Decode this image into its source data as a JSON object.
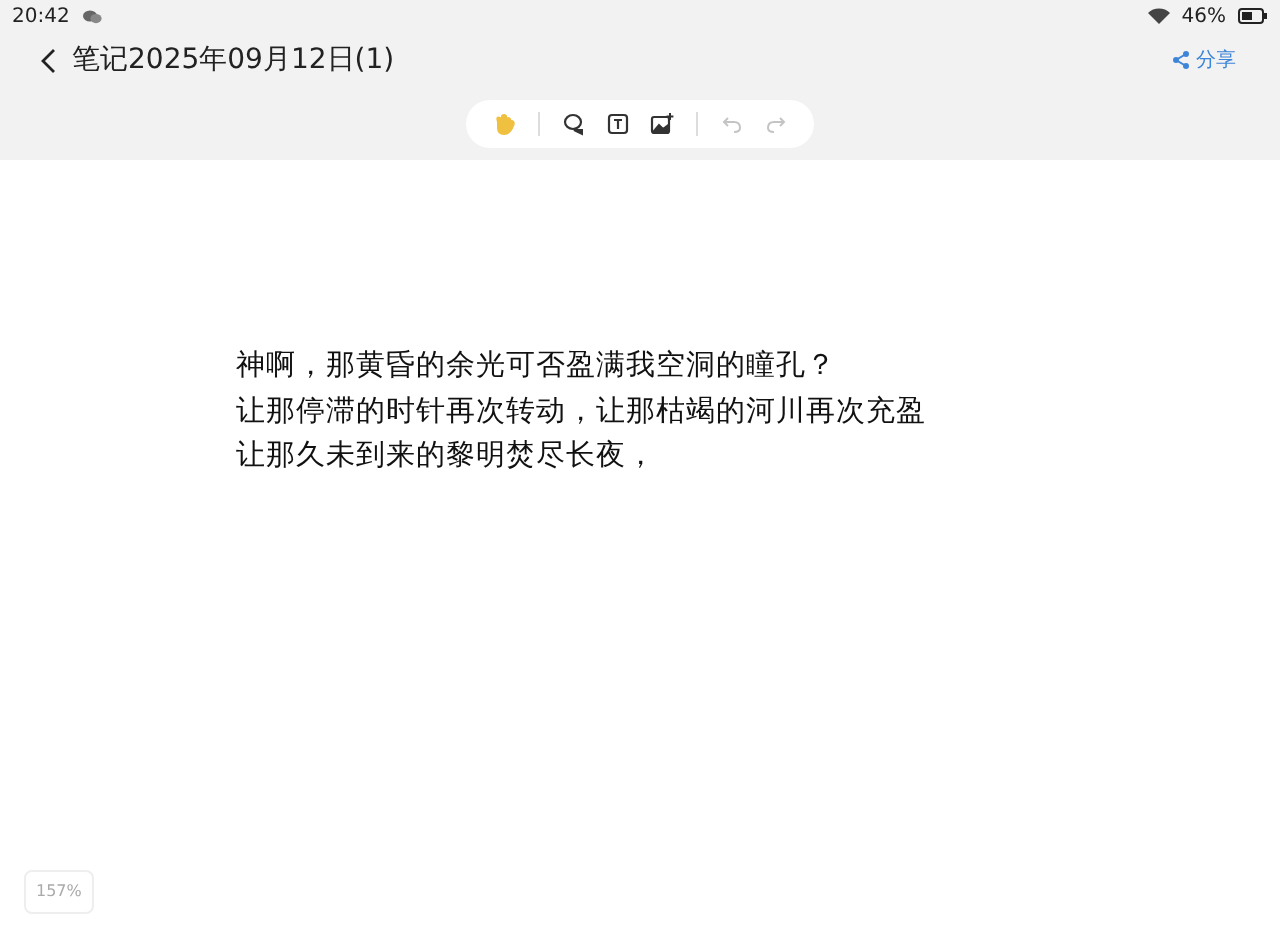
{
  "status_bar": {
    "time": "20:42",
    "battery": "46%"
  },
  "header": {
    "title": "笔记2025年09月12日(1)",
    "share": "分享"
  },
  "toolbar": {
    "tools": [
      {
        "kind": "hand",
        "selected": true,
        "disabled": false
      },
      {
        "kind": "lasso",
        "selected": false,
        "disabled": false
      },
      {
        "kind": "text",
        "selected": false,
        "disabled": false
      },
      {
        "kind": "image",
        "selected": false,
        "disabled": false
      },
      {
        "kind": "undo",
        "selected": false,
        "disabled": true
      },
      {
        "kind": "redo",
        "selected": false,
        "disabled": true
      }
    ]
  },
  "note": {
    "lines": [
      "神啊，那黄昏的余光可否盈满我空洞的瞳孔？",
      "让那停滞的时针再次转动，让那枯竭的河川再次充盈",
      "让那久未到来的黎明焚尽长夜，"
    ]
  },
  "zoom": "157%"
}
